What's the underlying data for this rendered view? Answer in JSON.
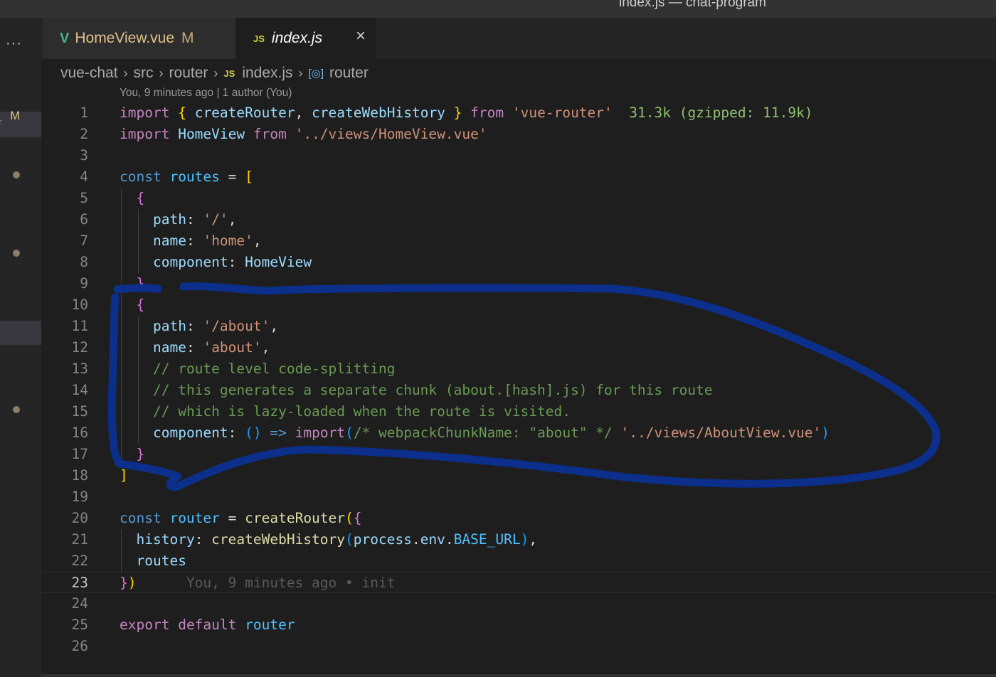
{
  "window": {
    "title": "index.js — chat-program"
  },
  "activity_bar": {
    "more_label": "···",
    "scm_badge": "M"
  },
  "tabs": [
    {
      "label": "HomeView.vue",
      "icon": "vue-icon",
      "modified_marker": "M",
      "active": false
    },
    {
      "label": "index.js",
      "icon": "js-icon",
      "close": "×",
      "active": true
    }
  ],
  "breadcrumb": {
    "items": [
      "vue-chat",
      "src",
      "router",
      "index.js",
      "router"
    ],
    "file_icon": "JS",
    "symbol_icon": "[◎]",
    "separator": "›"
  },
  "codelens": "You, 9 minutes ago | 1 author (You)",
  "editor": {
    "current_line": 23,
    "lines": [
      {
        "n": "1",
        "indent": 0,
        "t": [
          [
            "k",
            "import"
          ],
          [
            "p",
            " "
          ],
          [
            "b1",
            "{"
          ],
          [
            "p",
            " "
          ],
          [
            "v",
            "createRouter"
          ],
          [
            "p",
            ", "
          ],
          [
            "v",
            "createWebHistory"
          ],
          [
            "p",
            " "
          ],
          [
            "b1",
            "}"
          ],
          [
            "p",
            " "
          ],
          [
            "k",
            "from"
          ],
          [
            "p",
            " "
          ],
          [
            "s",
            "'vue-router'"
          ],
          [
            "p",
            "  "
          ],
          [
            "size",
            "31.3k (gzipped: 11.9k)"
          ]
        ]
      },
      {
        "n": "2",
        "indent": 0,
        "t": [
          [
            "k",
            "import"
          ],
          [
            "p",
            " "
          ],
          [
            "v",
            "HomeView"
          ],
          [
            "p",
            " "
          ],
          [
            "k",
            "from"
          ],
          [
            "p",
            " "
          ],
          [
            "s",
            "'../views/HomeView.vue'"
          ]
        ]
      },
      {
        "n": "3",
        "indent": 0,
        "t": []
      },
      {
        "n": "4",
        "indent": 0,
        "t": [
          [
            "kw",
            "const"
          ],
          [
            "p",
            " "
          ],
          [
            "cst",
            "routes"
          ],
          [
            "p",
            " = "
          ],
          [
            "b1",
            "["
          ]
        ]
      },
      {
        "n": "5",
        "indent": 1,
        "t": [
          [
            "b2",
            "{"
          ]
        ]
      },
      {
        "n": "6",
        "indent": 2,
        "t": [
          [
            "v",
            "path"
          ],
          [
            "p",
            ": "
          ],
          [
            "s",
            "'/'"
          ],
          [
            "p",
            ","
          ]
        ]
      },
      {
        "n": "7",
        "indent": 2,
        "t": [
          [
            "v",
            "name"
          ],
          [
            "p",
            ": "
          ],
          [
            "s",
            "'home'"
          ],
          [
            "p",
            ","
          ]
        ]
      },
      {
        "n": "8",
        "indent": 2,
        "t": [
          [
            "v",
            "component"
          ],
          [
            "p",
            ": "
          ],
          [
            "v",
            "HomeView"
          ]
        ]
      },
      {
        "n": "9",
        "indent": 1,
        "t": [
          [
            "b2",
            "}"
          ],
          [
            "p",
            ","
          ]
        ]
      },
      {
        "n": "10",
        "indent": 1,
        "t": [
          [
            "b2",
            "{"
          ]
        ]
      },
      {
        "n": "11",
        "indent": 2,
        "t": [
          [
            "v",
            "path"
          ],
          [
            "p",
            ": "
          ],
          [
            "s",
            "'/about'"
          ],
          [
            "p",
            ","
          ]
        ]
      },
      {
        "n": "12",
        "indent": 2,
        "t": [
          [
            "v",
            "name"
          ],
          [
            "p",
            ": "
          ],
          [
            "s",
            "'about'"
          ],
          [
            "p",
            ","
          ]
        ]
      },
      {
        "n": "13",
        "indent": 2,
        "t": [
          [
            "c",
            "// route level code-splitting"
          ]
        ]
      },
      {
        "n": "14",
        "indent": 2,
        "t": [
          [
            "c",
            "// this generates a separate chunk (about.[hash].js) for this route"
          ]
        ]
      },
      {
        "n": "15",
        "indent": 2,
        "t": [
          [
            "c",
            "// which is lazy-loaded when the route is visited."
          ]
        ]
      },
      {
        "n": "16",
        "indent": 2,
        "t": [
          [
            "v",
            "component"
          ],
          [
            "p",
            ": "
          ],
          [
            "b3",
            "()"
          ],
          [
            "p",
            " "
          ],
          [
            "kw",
            "=>"
          ],
          [
            "p",
            " "
          ],
          [
            "k",
            "import"
          ],
          [
            "b3",
            "("
          ],
          [
            "c",
            "/* webpackChunkName: \"about\" */"
          ],
          [
            "p",
            " "
          ],
          [
            "s",
            "'../views/AboutView.vue'"
          ],
          [
            "b3",
            ")"
          ]
        ]
      },
      {
        "n": "17",
        "indent": 1,
        "t": [
          [
            "b2",
            "}"
          ]
        ]
      },
      {
        "n": "18",
        "indent": 0,
        "t": [
          [
            "b1",
            "]"
          ]
        ]
      },
      {
        "n": "19",
        "indent": 0,
        "t": []
      },
      {
        "n": "20",
        "indent": 0,
        "t": [
          [
            "kw",
            "const"
          ],
          [
            "p",
            " "
          ],
          [
            "cst",
            "router"
          ],
          [
            "p",
            " = "
          ],
          [
            "f",
            "createRouter"
          ],
          [
            "b1",
            "("
          ],
          [
            "b2",
            "{"
          ]
        ]
      },
      {
        "n": "21",
        "indent": 1,
        "t": [
          [
            "v",
            "history"
          ],
          [
            "p",
            ": "
          ],
          [
            "f",
            "createWebHistory"
          ],
          [
            "b3",
            "("
          ],
          [
            "v",
            "process"
          ],
          [
            "p",
            "."
          ],
          [
            "v",
            "env"
          ],
          [
            "p",
            "."
          ],
          [
            "cst",
            "BASE_URL"
          ],
          [
            "b3",
            ")"
          ],
          [
            "p",
            ","
          ]
        ]
      },
      {
        "n": "22",
        "indent": 1,
        "t": [
          [
            "v",
            "routes"
          ]
        ]
      },
      {
        "n": "23",
        "indent": 0,
        "t": [
          [
            "b2",
            "}"
          ],
          [
            "b1",
            ")"
          ],
          [
            "p",
            "      "
          ],
          [
            "blame",
            "You, 9 minutes ago • init"
          ]
        ]
      },
      {
        "n": "24",
        "indent": 0,
        "t": []
      },
      {
        "n": "25",
        "indent": 0,
        "t": [
          [
            "k",
            "export"
          ],
          [
            "p",
            " "
          ],
          [
            "k",
            "default"
          ],
          [
            "p",
            " "
          ],
          [
            "cst",
            "router"
          ]
        ]
      },
      {
        "n": "26",
        "indent": 0,
        "t": []
      }
    ]
  },
  "annotation": {
    "color": "#0b2f8a",
    "shape": "hand-drawn-loop"
  }
}
